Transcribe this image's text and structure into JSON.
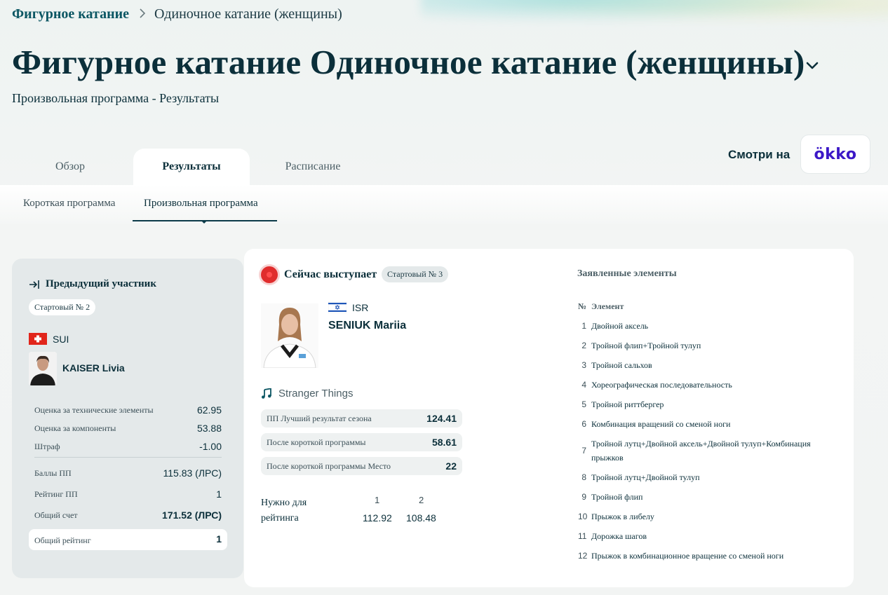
{
  "breadcrumb": {
    "root": "Фигурное катание",
    "current": "Одиночное катание (женщины)"
  },
  "page": {
    "title": "Фигурное катание Одиночное катание (женщины)",
    "subtitle": "Произвольная программа - Результаты"
  },
  "tabs": [
    "Обзор",
    "Результаты",
    "Расписание"
  ],
  "active_tab": "Результаты",
  "watch": {
    "label": "Смотри на",
    "partner": "ökko",
    "partner_color": "#3c18c7"
  },
  "subtabs": [
    "Короткая программа",
    "Произвольная программа"
  ],
  "active_subtab": "Произвольная программа",
  "previous": {
    "heading": "Предыдущий участник",
    "start_no": "Стартовый № 2",
    "country": "SUI",
    "name": "KAISER Livia",
    "scores": [
      {
        "label": "Оценка за технические элементы",
        "value": "62.95"
      },
      {
        "label": "Оценка за компоненты",
        "value": "53.88"
      },
      {
        "label": "Штраф",
        "value": "-1.00"
      },
      {
        "label": "Баллы ПП",
        "value": "115.83 (ЛРС)"
      },
      {
        "label": "Рейтинг ПП",
        "value": "1"
      },
      {
        "label": "Общий счет",
        "value": "171.52 (ЛРС)"
      }
    ],
    "overall": {
      "label": "Общий рейтинг",
      "value": "1"
    }
  },
  "current": {
    "label": "Сейчас выступает",
    "start_no": "Стартовый № 3",
    "country": "ISR",
    "name": "SENIUK Mariia",
    "music": "Stranger Things",
    "stats": [
      {
        "label": "ПП Лучший результат сезона",
        "value": "124.41"
      },
      {
        "label": "После короткой программы",
        "value": "58.61"
      },
      {
        "label": "После короткой программы Место",
        "value": "22"
      }
    ],
    "need": {
      "label": "Нужно для рейтинга",
      "ranks": [
        "1",
        "2"
      ],
      "values": [
        "112.92",
        "108.48"
      ]
    }
  },
  "elements": {
    "title": "Заявленные элементы",
    "col_no": "№",
    "col_name": "Элемент",
    "items": [
      {
        "n": "1",
        "name": "Двойной аксель"
      },
      {
        "n": "2",
        "name": "Тройной флип+Тройной тулуп"
      },
      {
        "n": "3",
        "name": "Тройной сальхов"
      },
      {
        "n": "4",
        "name": "Хореографическая последовательность"
      },
      {
        "n": "5",
        "name": "Тройной риттбергер"
      },
      {
        "n": "6",
        "name": "Комбинация вращений со сменой ноги"
      },
      {
        "n": "7",
        "name": "Тройной лутц+Двойной аксель+Двойной тулуп+Комбинация прыжков"
      },
      {
        "n": "8",
        "name": "Тройной лутц+Двойной тулуп"
      },
      {
        "n": "9",
        "name": "Тройной флип"
      },
      {
        "n": "10",
        "name": "Прыжок в либелу"
      },
      {
        "n": "11",
        "name": "Дорожка шагов"
      },
      {
        "n": "12",
        "name": "Прыжок в комбинационное вращение со сменой ноги"
      }
    ]
  },
  "colors": {
    "live": "#e02c2c",
    "accent": "#0b5663",
    "text": "#0b2f3a"
  }
}
